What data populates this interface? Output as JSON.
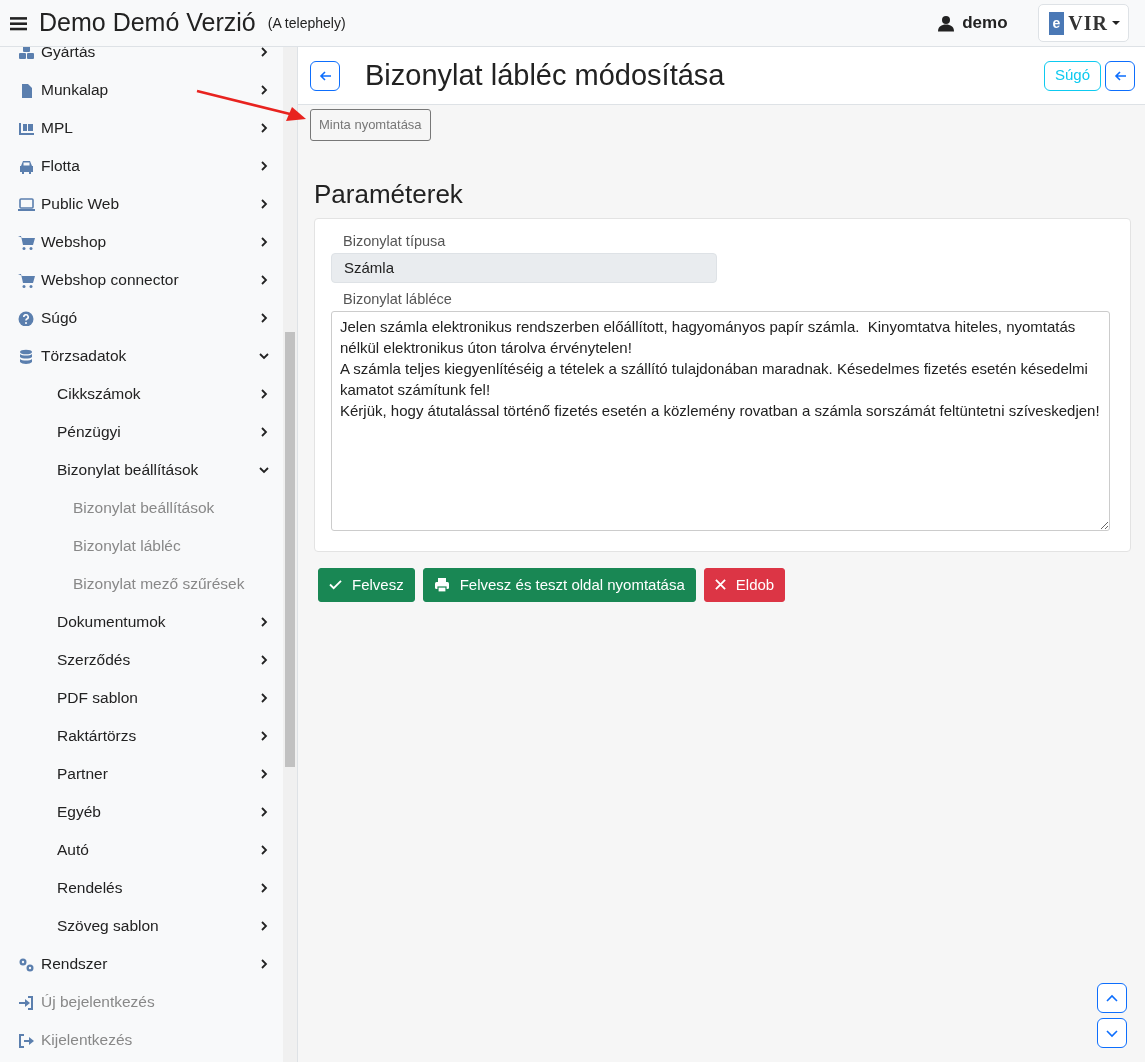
{
  "navbar": {
    "title": "Demo Demó Verzió",
    "subtitle": "(A telephely)",
    "user": "demo",
    "logo": {
      "letter": "e",
      "text": "VIR"
    }
  },
  "sidebar": {
    "items": [
      {
        "kind": "menu",
        "label": "Gyártás",
        "expanded": false
      },
      {
        "kind": "menu",
        "label": "Munkalap",
        "expanded": false
      },
      {
        "kind": "menu",
        "label": "MPL",
        "expanded": false
      },
      {
        "kind": "menu",
        "label": "Flotta",
        "expanded": false
      },
      {
        "kind": "menu",
        "label": "Public Web",
        "expanded": false
      },
      {
        "kind": "menu",
        "label": "Webshop",
        "expanded": false
      },
      {
        "kind": "menu",
        "label": "Webshop connector",
        "expanded": false
      },
      {
        "kind": "menu",
        "label": "Súgó",
        "expanded": false
      },
      {
        "kind": "menu",
        "label": "Törzsadatok",
        "expanded": true,
        "children": [
          {
            "kind": "menu",
            "label": "Cikkszámok",
            "expanded": false
          },
          {
            "kind": "menu",
            "label": "Pénzügyi",
            "expanded": false
          },
          {
            "kind": "menu",
            "label": "Bizonylat beállítások",
            "expanded": true,
            "children": [
              {
                "kind": "link",
                "label": "Bizonylat beállítások"
              },
              {
                "kind": "link",
                "label": "Bizonylat lábléc"
              },
              {
                "kind": "link",
                "label": "Bizonylat mező szűrések"
              }
            ]
          },
          {
            "kind": "menu",
            "label": "Dokumentumok",
            "expanded": false
          },
          {
            "kind": "menu",
            "label": "Szerződés",
            "expanded": false
          },
          {
            "kind": "menu",
            "label": "PDF sablon",
            "expanded": false
          },
          {
            "kind": "menu",
            "label": "Raktártörzs",
            "expanded": false
          },
          {
            "kind": "menu",
            "label": "Partner",
            "expanded": false
          },
          {
            "kind": "menu",
            "label": "Egyéb",
            "expanded": false
          },
          {
            "kind": "menu",
            "label": "Autó",
            "expanded": false
          },
          {
            "kind": "menu",
            "label": "Rendelés",
            "expanded": false
          },
          {
            "kind": "menu",
            "label": "Szöveg sablon",
            "expanded": false
          }
        ]
      },
      {
        "kind": "menu",
        "label": "Rendszer",
        "expanded": false
      },
      {
        "kind": "action",
        "label": "Új bejelentkezés"
      },
      {
        "kind": "action",
        "label": "Kijelentkezés"
      }
    ]
  },
  "page": {
    "title": "Bizonylat lábléc módosítása",
    "help_button": "Súgó",
    "sample_button": "Minta nyomtatása",
    "section_title": "Paraméterek",
    "fields": [
      {
        "kind": "input",
        "label": "Bizonylat típusa",
        "value": "Számla",
        "disabled": true
      },
      {
        "kind": "textarea",
        "label": "Bizonylat lábléce",
        "value": "Jelen számla elektronikus rendszerben előállított, hagyományos papír számla.  Kinyomtatva hiteles, nyomtatás nélkül elektronikus úton tárolva érvénytelen!\nA számla teljes kiegyenlítéséig a tételek a szállító tulajdonában maradnak. Késedelmes fizetés esetén késedelmi kamatot számítunk fel!\nKérjük, hogy átutalással történő fizetés esetén a közlemény rovatban a számla sorszámát feltüntetni szíveskedjen!",
        "disabled": false
      }
    ],
    "actions": [
      {
        "kind": "save",
        "label": "Felvesz"
      },
      {
        "kind": "print",
        "label": "Felvesz és teszt oldal nyomtatása"
      },
      {
        "kind": "discard",
        "label": "Eldob"
      }
    ]
  }
}
